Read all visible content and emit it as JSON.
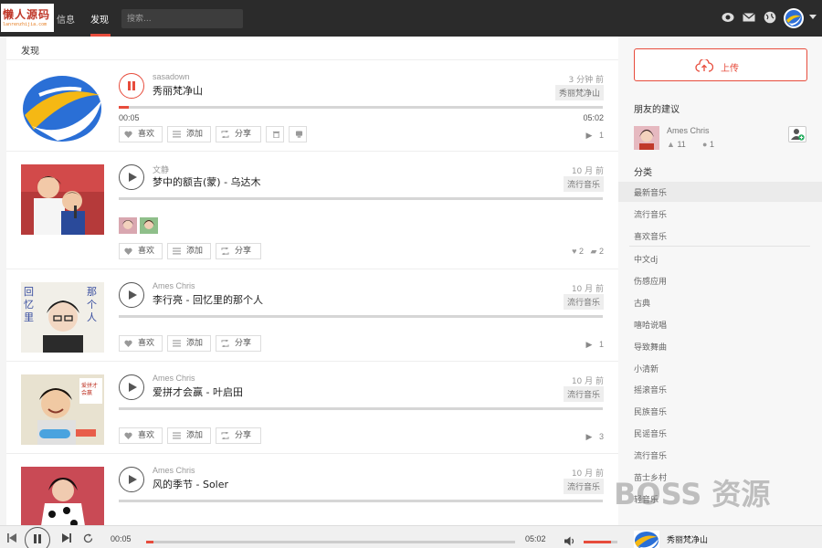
{
  "topbar": {
    "logo_text": "懒人源码",
    "logo_sub": "lanrenzhijia.com",
    "nav": [
      "信息",
      "发现"
    ],
    "search_placeholder": "搜索..."
  },
  "main": {
    "header": "发现",
    "tracks": [
      {
        "artist": "sasadown",
        "title": "秀丽梵净山",
        "time_ago": "3 分钟 前",
        "tag": "秀丽梵净山",
        "playing": true,
        "current_time": "00:05",
        "duration": "05:02",
        "progress": 0.02,
        "actions": [
          "喜欢",
          "添加",
          "分享"
        ],
        "plays": "1"
      },
      {
        "artist": "文静",
        "title": "梦中的额吉(蒙) - 乌达木",
        "time_ago": "10 月 前",
        "tag": "流行音乐",
        "actions": [
          "喜欢",
          "添加",
          "分享"
        ],
        "likes": "2",
        "comments": "2"
      },
      {
        "artist": "Ames Chris",
        "title": "李行亮 - 回忆里的那个人",
        "time_ago": "10 月 前",
        "tag": "流行音乐",
        "actions": [
          "喜欢",
          "添加",
          "分享"
        ],
        "plays": "1"
      },
      {
        "artist": "Ames Chris",
        "title": "爱拼才会赢 - 叶启田",
        "time_ago": "10 月 前",
        "tag": "流行音乐",
        "actions": [
          "喜欢",
          "添加",
          "分享"
        ],
        "plays": "3"
      },
      {
        "artist": "Ames Chris",
        "title": "风的季节 - Soler",
        "time_ago": "10 月 前",
        "tag": "流行音乐"
      }
    ]
  },
  "sidebar": {
    "upload_label": "上传",
    "friends_heading": "朋友的建议",
    "friend": {
      "name": "Ames Chris",
      "likes": "11",
      "follows": "1"
    },
    "categories_heading": "分类",
    "categories": [
      "最新音乐",
      "流行音乐",
      "喜欢音乐",
      "中文dj",
      "伤感应用",
      "古典",
      "嘻哈说唱",
      "导致舞曲",
      "小清新",
      "摇滚音乐",
      "民族音乐",
      "民谣音乐",
      "流行音乐",
      "苗士乡村",
      "轻音乐"
    ]
  },
  "player": {
    "current_time": "00:05",
    "duration": "05:02",
    "progress": 0.02,
    "volume": 0.8,
    "now_playing": "秀丽梵净山"
  },
  "watermark": "BOSS 资源",
  "colors": {
    "accent": "#e74c3c",
    "topbar": "#2b2b2b"
  }
}
